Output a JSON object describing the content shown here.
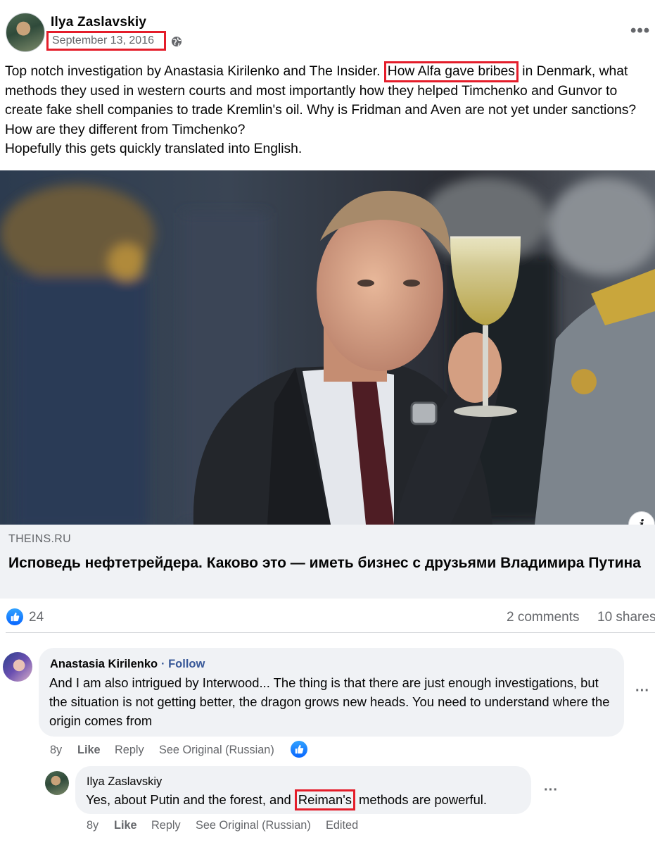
{
  "post": {
    "author": "Ilya Zaslavskiy",
    "date": "September 13, 2016",
    "privacy_icon": "globe-icon",
    "more_icon": "more-horizontal-icon",
    "text_before_highlight": "Top notch investigation by Anastasia Kirilenko and The Insider. ",
    "text_highlight": "How Alfa gave bribes",
    "text_after_highlight": " in Denmark, what methods they used in western courts and most importantly how they helped Timchenko and Gunvor to create fake shell companies to trade Kremlin's oil. Why is Fridman and Aven are not yet under sanctions? How are they different from Timchenko?",
    "text_line2": "Hopefully this gets quickly translated into English."
  },
  "link_preview": {
    "domain": "THEINS.RU",
    "title": "Исповедь нефтетрейдера. Каково это — иметь бизнес с друзьями Владимира Путина",
    "info_icon": "info-icon"
  },
  "stats": {
    "like_count": "24",
    "comments": "2 comments",
    "shares": "10 shares"
  },
  "comments": [
    {
      "author": "Anastasia Kirilenko",
      "follow": "· Follow",
      "text": "And I am also intrigued by Interwood... The thing is that there are just enough investigations, but the situation is not getting better, the dragon grows new heads. You need to understand where the origin comes from",
      "age": "8y",
      "like": "Like",
      "reply": "Reply",
      "see_original": "See Original (Russian)"
    },
    {
      "author": "Ilya Zaslavskiy",
      "text_before_highlight": "Yes, about Putin and the forest, and ",
      "text_highlight": "Reiman's",
      "text_after_highlight": " methods are powerful.",
      "age": "8y",
      "like": "Like",
      "reply": "Reply",
      "see_original": "See Original (Russian)",
      "edited": "Edited"
    }
  ],
  "colors": {
    "highlight_box": "#e41d2a",
    "facebook_blue": "#0866ff",
    "secondary_text": "#65676b",
    "bubble_bg": "#f0f2f5"
  }
}
